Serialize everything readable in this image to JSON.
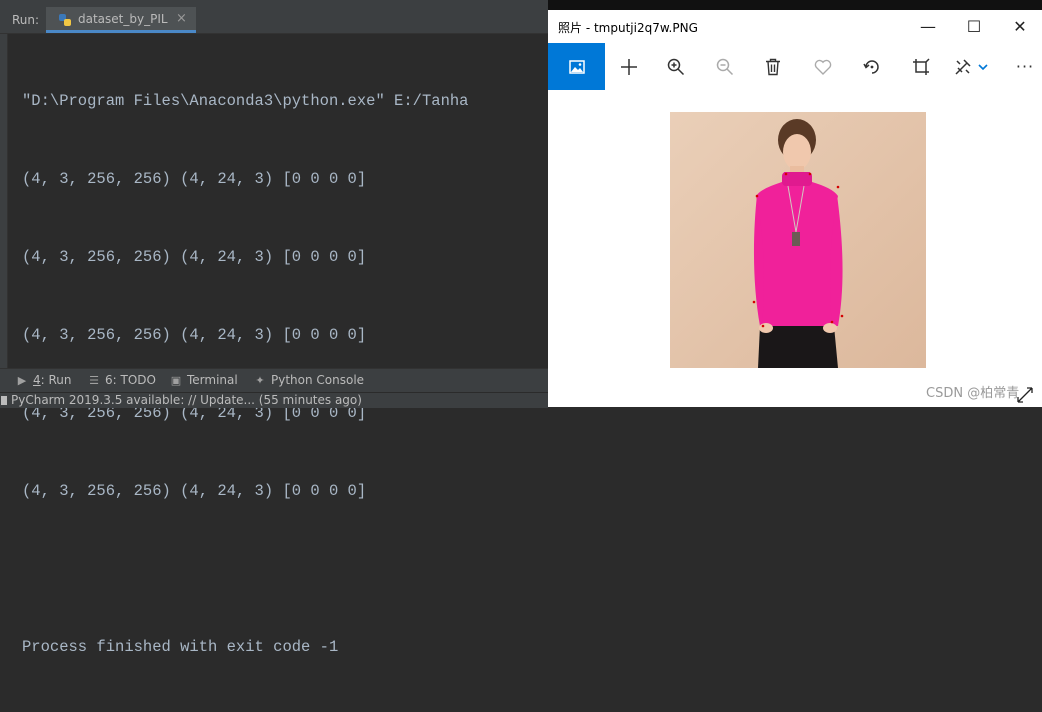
{
  "ide": {
    "run_label": "Run:",
    "run_tab": "dataset_by_PIL",
    "run_tab_close": "×",
    "console_lines": [
      "\"D:\\Program Files\\Anaconda3\\python.exe\" E:/Tanha",
      "(4, 3, 256, 256) (4, 24, 3) [0 0 0 0]",
      "(4, 3, 256, 256) (4, 24, 3) [0 0 0 0]",
      "(4, 3, 256, 256) (4, 24, 3) [0 0 0 0]",
      "(4, 3, 256, 256) (4, 24, 3) [0 0 0 0]",
      "(4, 3, 256, 256) (4, 24, 3) [0 0 0 0]",
      "",
      "Process finished with exit code -1"
    ],
    "tool_windows": {
      "run_num": "4",
      "run_rest": ": Run",
      "todo": "6: TODO",
      "terminal": "Terminal",
      "python_console": "Python Console"
    },
    "status": "PyCharm 2019.3.5 available: // Update... (55 minutes ago)"
  },
  "photos": {
    "title": "照片 - tmputji2q7w.PNG",
    "window_controls": {
      "minimize": "—",
      "maximize": "☐",
      "close": "✕"
    },
    "more": "···",
    "watermark": "CSDN @柏常青",
    "icons": [
      "image-icon",
      "add-icon",
      "zoom-in-icon",
      "zoom-out-icon",
      "delete-icon",
      "favorite-icon",
      "rotate-icon",
      "crop-icon",
      "edit-icon",
      "more-icon"
    ]
  },
  "colors": {
    "ide_bg": "#2b2b2b",
    "console_text": "#a9b7c6",
    "accent_blue": "#0078d7",
    "sweater": "#f0219a",
    "photo_bg": "#e8c9b0"
  }
}
